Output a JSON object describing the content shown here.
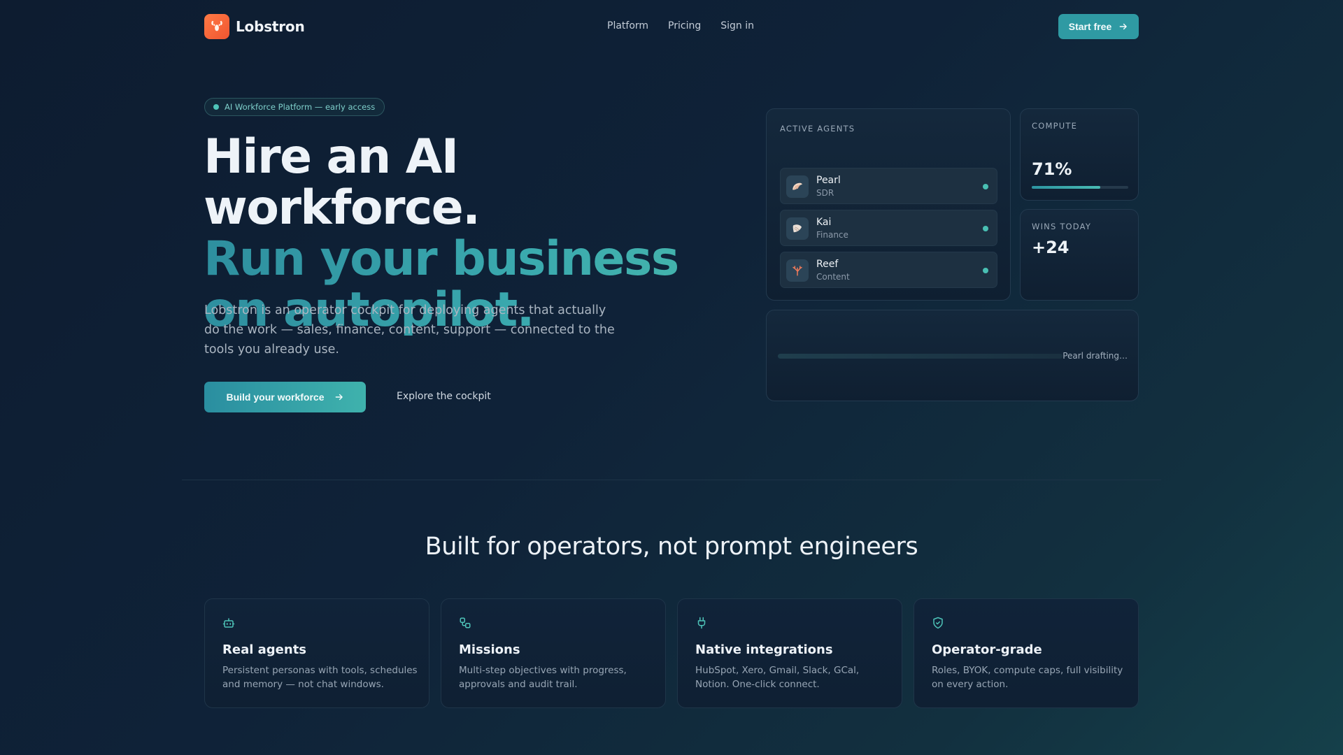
{
  "nav": {
    "brand": "Lobstron",
    "links": [
      "Platform",
      "Pricing",
      "Sign in"
    ],
    "cta": "Start free"
  },
  "hero": {
    "badge": "AI Workforce Platform — early access",
    "title_line1": "Hire an AI workforce.",
    "title_line2": "Run your business on autopilot.",
    "subtitle": "Lobstron is an operator cockpit for deploying agents that actually do the work — sales, finance, content, support — connected to the tools you already use.",
    "primary_cta": "Build your workforce",
    "secondary_cta": "Explore the cockpit"
  },
  "dashboard": {
    "agents_label": "ACTIVE AGENTS",
    "agents": [
      {
        "name": "Pearl",
        "role": "SDR",
        "icon": "shell-icon"
      },
      {
        "name": "Kai",
        "role": "Finance",
        "icon": "conch-icon"
      },
      {
        "name": "Reef",
        "role": "Content",
        "icon": "coral-icon"
      }
    ],
    "compute_label": "COMPUTE",
    "compute_value": "71%",
    "compute_fraction": 0.71,
    "wins_label": "WINS TODAY",
    "wins_value": "+24",
    "activity_text": "Pearl drafting…"
  },
  "features": {
    "title": "Built for operators, not prompt engineers",
    "cards": [
      {
        "title": "Real agents",
        "desc": "Persistent personas with tools, schedules and memory — not chat windows.",
        "icon": "robot-icon"
      },
      {
        "title": "Missions",
        "desc": "Multi-step objectives with progress, approvals and audit trail.",
        "icon": "workflow-icon"
      },
      {
        "title": "Native integrations",
        "desc": "HubSpot, Xero, Gmail, Slack, GCal, Notion. One-click connect.",
        "icon": "plug-icon"
      },
      {
        "title": "Operator-grade",
        "desc": "Roles, BYOK, compute caps, full visibility on every action.",
        "icon": "shield-check-icon"
      }
    ]
  },
  "colors": {
    "accent": "#2f9aa3",
    "accent_light": "#49bbb3",
    "brand": "#f05530"
  }
}
